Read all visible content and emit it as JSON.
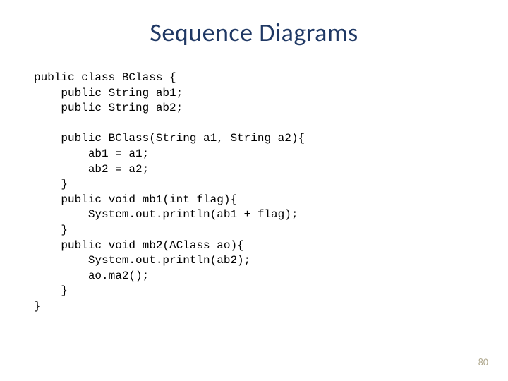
{
  "title": "Sequence Diagrams",
  "code": {
    "l01": "public class BClass {",
    "l02": "    public String ab1;",
    "l03": "    public String ab2;",
    "l04": "",
    "l05": "    public BClass(String a1, String a2){",
    "l06": "        ab1 = a1;",
    "l07": "        ab2 = a2;",
    "l08": "    }",
    "l09": "    public void mb1(int flag){",
    "l10": "        System.out.println(ab1 + flag);",
    "l11": "    }",
    "l12": "    public void mb2(AClass ao){",
    "l13": "        System.out.println(ab2);",
    "l14": "        ao.ma2();",
    "l15": "    }",
    "l16": "}"
  },
  "page_number": "80"
}
